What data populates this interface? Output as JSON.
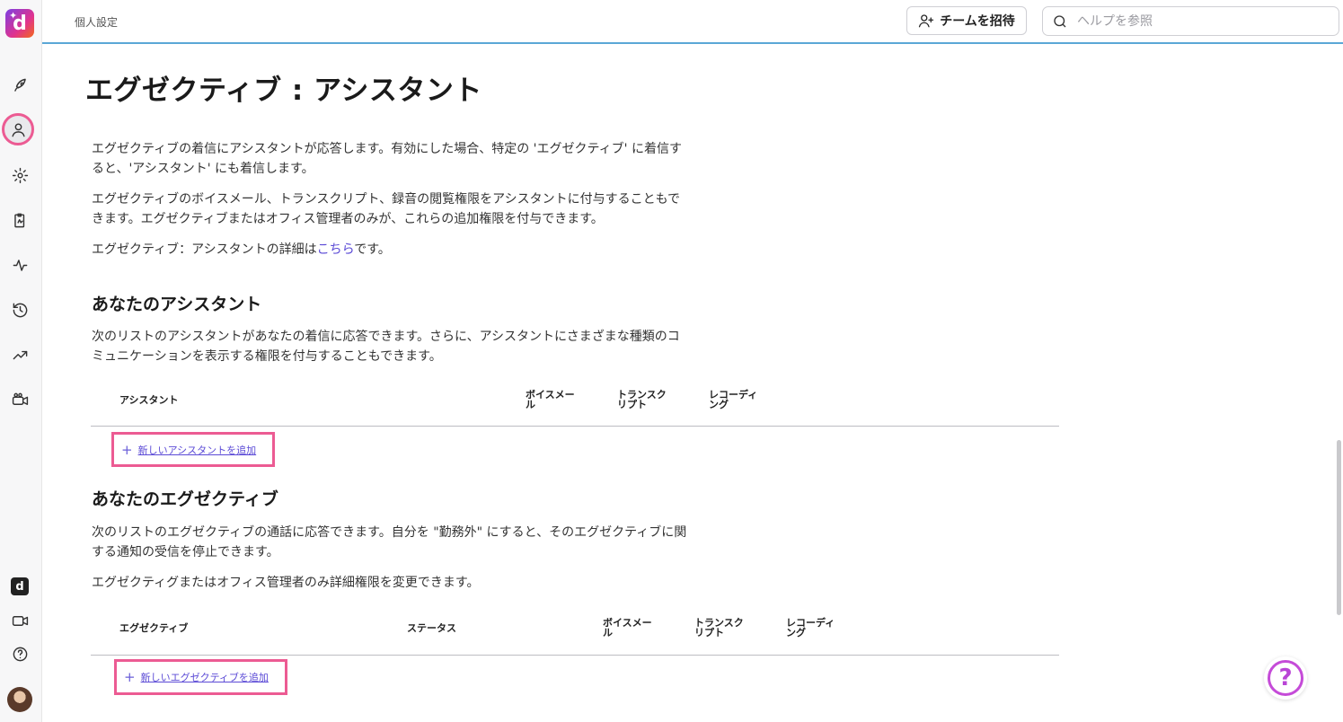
{
  "header": {
    "title": "個人設定",
    "invite_label": "チームを招待",
    "search_placeholder": "ヘルプを参照"
  },
  "sidebar": {
    "logo_letter": "d",
    "small_logo_letter": "d",
    "icons": [
      "rocket-icon",
      "person-icon",
      "gear-icon",
      "clipboard-icon",
      "activity-icon",
      "history-icon",
      "trending-icon",
      "video-camera-icon",
      "video-icon",
      "help-circle-icon"
    ]
  },
  "page": {
    "title": "エグゼクティブ : アシスタント",
    "intro": {
      "p1": "エグゼクティブの着信にアシスタントが応答します。有効にした場合、特定の 'エグゼクティブ' に着信すると、'アシスタント' にも着信します。",
      "p2": "エグゼクティブのボイスメール、トランスクリプト、録音の閲覧権限をアシスタントに付与することもできます。エグゼクティブまたはオフィス管理者のみが、これらの追加権限を付与できます。",
      "p3_before": "エグゼクティブ：アシスタントの詳細は",
      "p3_link": "こちら",
      "p3_after": "です。"
    },
    "assistants": {
      "heading": "あなたのアシスタント",
      "description": "次のリストのアシスタントがあなたの着信に応答できます。さらに、アシスタントにさまざまな種類のコミュニケーションを表示する権限を付与することもできます。",
      "columns": [
        "アシスタント",
        "ボイスメール",
        "トランスクリプト",
        "レコーディング"
      ],
      "add_label": "新しいアシスタントを追加"
    },
    "executives": {
      "heading": "あなたのエグゼクティブ",
      "description": "次のリストのエグゼクティブの通話に応答できます。自分を \"勤務外\" にすると、そのエグゼクティブに関する通知の受信を停止できます。",
      "note": "エグゼクティグまたはオフィス管理者のみ詳細権限を変更できます。",
      "columns": [
        "エグゼクティブ",
        "ステータス",
        "ボイスメール",
        "トランスクリプト",
        "レコーディング"
      ],
      "add_label": "新しいエグゼクティブを追加"
    }
  },
  "help_fab": "?"
}
